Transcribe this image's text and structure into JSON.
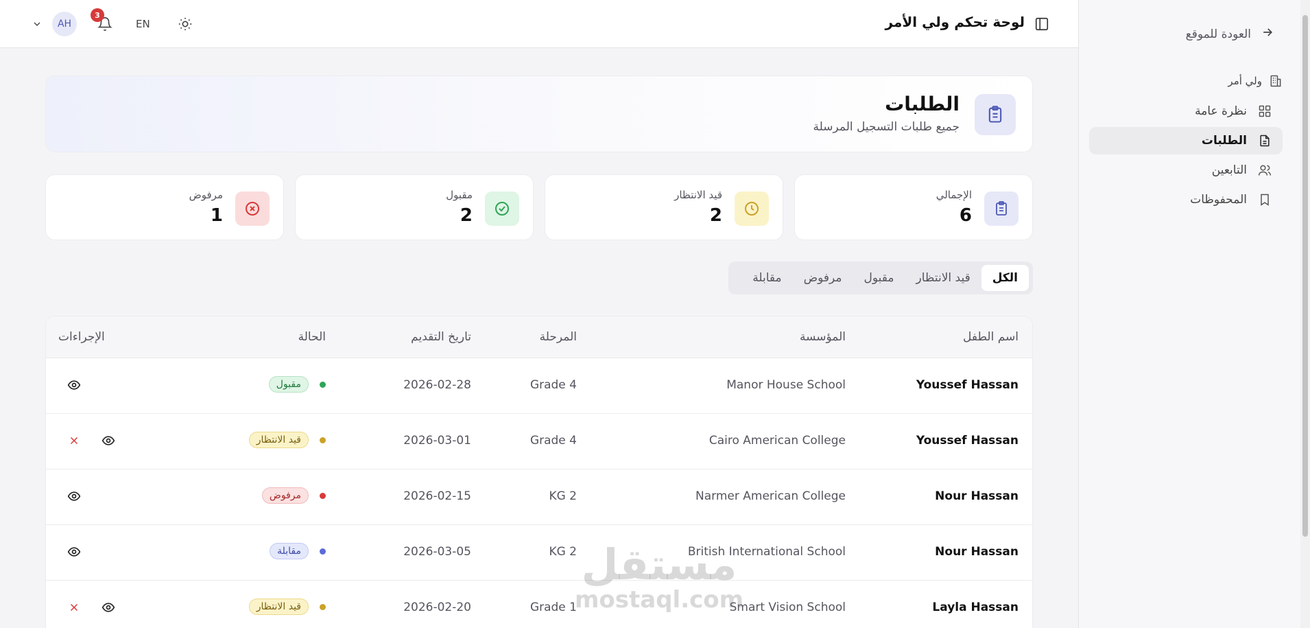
{
  "sidebar": {
    "back_label": "العودة للموقع",
    "section_label": "ولي أمر",
    "items": [
      {
        "label": "نظرة عامة"
      },
      {
        "label": "الطلبات"
      },
      {
        "label": "التابعين"
      },
      {
        "label": "المحفوظات"
      }
    ]
  },
  "topbar": {
    "title": "لوحة تحكم ولي الأمر",
    "avatar_initials": "AH",
    "notification_count": "3",
    "language": "EN"
  },
  "header": {
    "title": "الطلبات",
    "subtitle": "جميع طلبات التسجيل المرسلة"
  },
  "stats": [
    {
      "label": "الإجمالي",
      "value": "6",
      "color": "#4d58b5",
      "bg": "#e6e8f8"
    },
    {
      "label": "قيد الانتظار",
      "value": "2",
      "color": "#c9a227",
      "bg": "#fbf3c8"
    },
    {
      "label": "مقبول",
      "value": "2",
      "color": "#2fa457",
      "bg": "#dff5e5"
    },
    {
      "label": "مرفوض",
      "value": "1",
      "color": "#d63a3a",
      "bg": "#fbdcdc"
    }
  ],
  "tabs": [
    {
      "label": "الكل"
    },
    {
      "label": "قيد الانتظار"
    },
    {
      "label": "مقبول"
    },
    {
      "label": "مرفوض"
    },
    {
      "label": "مقابلة"
    }
  ],
  "table": {
    "headers": {
      "child_name": "اسم الطفل",
      "institution": "المؤسسة",
      "grade": "المرحلة",
      "date": "تاريخ التقديم",
      "status": "الحالة",
      "actions": "الإجراءات"
    },
    "rows": [
      {
        "child_name": "Youssef Hassan",
        "institution": "Manor House School",
        "grade": "Grade 4",
        "date": "2026-02-28",
        "status": "مقبول",
        "status_key": "accepted"
      },
      {
        "child_name": "Youssef Hassan",
        "institution": "Cairo American College",
        "grade": "Grade 4",
        "date": "2026-03-01",
        "status": "قيد الانتظار",
        "status_key": "pending"
      },
      {
        "child_name": "Nour Hassan",
        "institution": "Narmer American College",
        "grade": "KG 2",
        "date": "2026-02-15",
        "status": "مرفوض",
        "status_key": "rejected"
      },
      {
        "child_name": "Nour Hassan",
        "institution": "British International School",
        "grade": "KG 2",
        "date": "2026-03-05",
        "status": "مقابلة",
        "status_key": "interview"
      },
      {
        "child_name": "Layla Hassan",
        "institution": "Smart Vision School",
        "grade": "Grade 1",
        "date": "2026-02-20",
        "status": "قيد الانتظار",
        "status_key": "pending"
      }
    ]
  },
  "status_colors": {
    "accepted": {
      "dot": "#2fa457",
      "bg": "#dff5e5",
      "border": "#b5e3c3",
      "text": "#1f7a3f"
    },
    "pending": {
      "dot": "#c9a227",
      "bg": "#fbf3c8",
      "border": "#ecd98a",
      "text": "#7a6110"
    },
    "rejected": {
      "dot": "#d63a3a",
      "bg": "#fbe1e1",
      "border": "#f0bcbc",
      "text": "#a32c2c"
    },
    "interview": {
      "dot": "#5b6bd8",
      "bg": "#e4e8fb",
      "border": "#c2caf2",
      "text": "#3e4aa8"
    }
  },
  "watermark": {
    "arabic": "مستقل",
    "latin": "mostaql.com"
  }
}
